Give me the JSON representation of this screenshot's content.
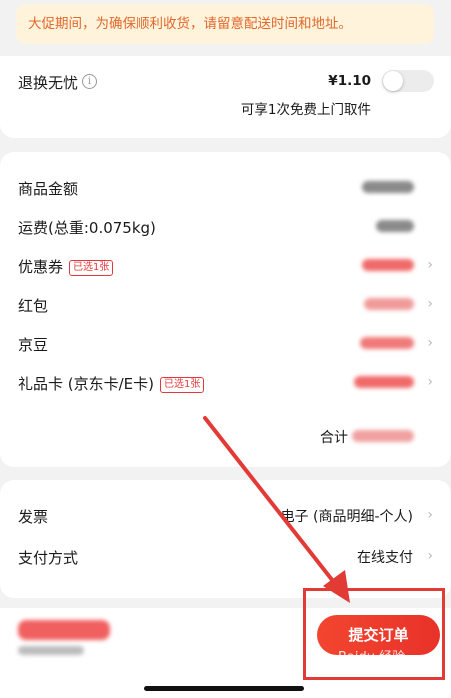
{
  "notice": {
    "text": "大促期间，为确保顺利收货，请留意配送时间和地址。"
  },
  "return_service": {
    "label": "退换无忧",
    "info_icon": "info-icon",
    "price": "¥1.10",
    "desc": "可享1次免费上门取件",
    "enabled": false
  },
  "summary": {
    "items": [
      {
        "label": "商品金额",
        "badge": "",
        "has_chevron": false
      },
      {
        "label": "运费(总重:0.075kg)",
        "badge": "",
        "has_chevron": false
      },
      {
        "label": "优惠券",
        "badge": "已选1张",
        "has_chevron": true
      },
      {
        "label": "红包",
        "badge": "",
        "has_chevron": true
      },
      {
        "label": "京豆",
        "badge": "",
        "has_chevron": true
      },
      {
        "label": "礼品卡 (京东卡/E卡)",
        "badge": "已选1张",
        "has_chevron": true
      }
    ],
    "total_label": "合计"
  },
  "payment": {
    "invoice_label": "发票",
    "invoice_value": "电子 (商品明细-个人)",
    "method_label": "支付方式",
    "method_value": "在线支付"
  },
  "bottom": {
    "submit_label": "提交订单",
    "watermark": "Baidu 经验"
  },
  "colors": {
    "accent": "#e4393c",
    "notice_bg": "#fff3dc",
    "notice_text": "#e0682c"
  },
  "icons": {
    "chevron": "chevron-right-icon",
    "arrow": "annotation-arrow"
  }
}
